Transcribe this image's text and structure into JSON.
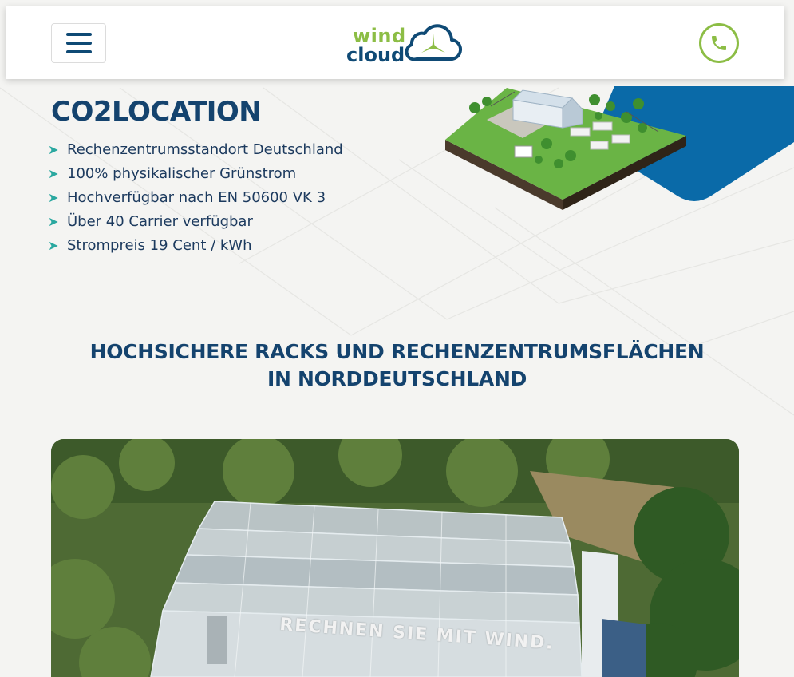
{
  "header": {
    "menu_icon": "hamburger-menu-icon",
    "logo": {
      "word1": "wind",
      "word2": "cloud"
    },
    "phone_icon": "phone-icon"
  },
  "colors": {
    "brand_blue": "#0f4a75",
    "brand_green": "#8cbd45",
    "bullet_teal": "#2aa8a0",
    "background": "#f4f4f2"
  },
  "hero": {
    "title": "CO2LOCATION",
    "features": [
      "Rechenzentrumsstandort Deutschland",
      "100% physikalischer Grünstrom",
      "Hochverfügbar nach EN 50600 VK 3",
      "Über 40 Carrier verfügbar",
      "Strompreis 19 Cent / kWh"
    ]
  },
  "section": {
    "title_line1": "HOCHSICHERE RACKS UND RECHENZENTRUMSFLÄCHEN",
    "title_line2": "IN NORDDEUTSCHLAND"
  },
  "photo": {
    "caption": "RECHNEN SIE MIT WIND."
  }
}
